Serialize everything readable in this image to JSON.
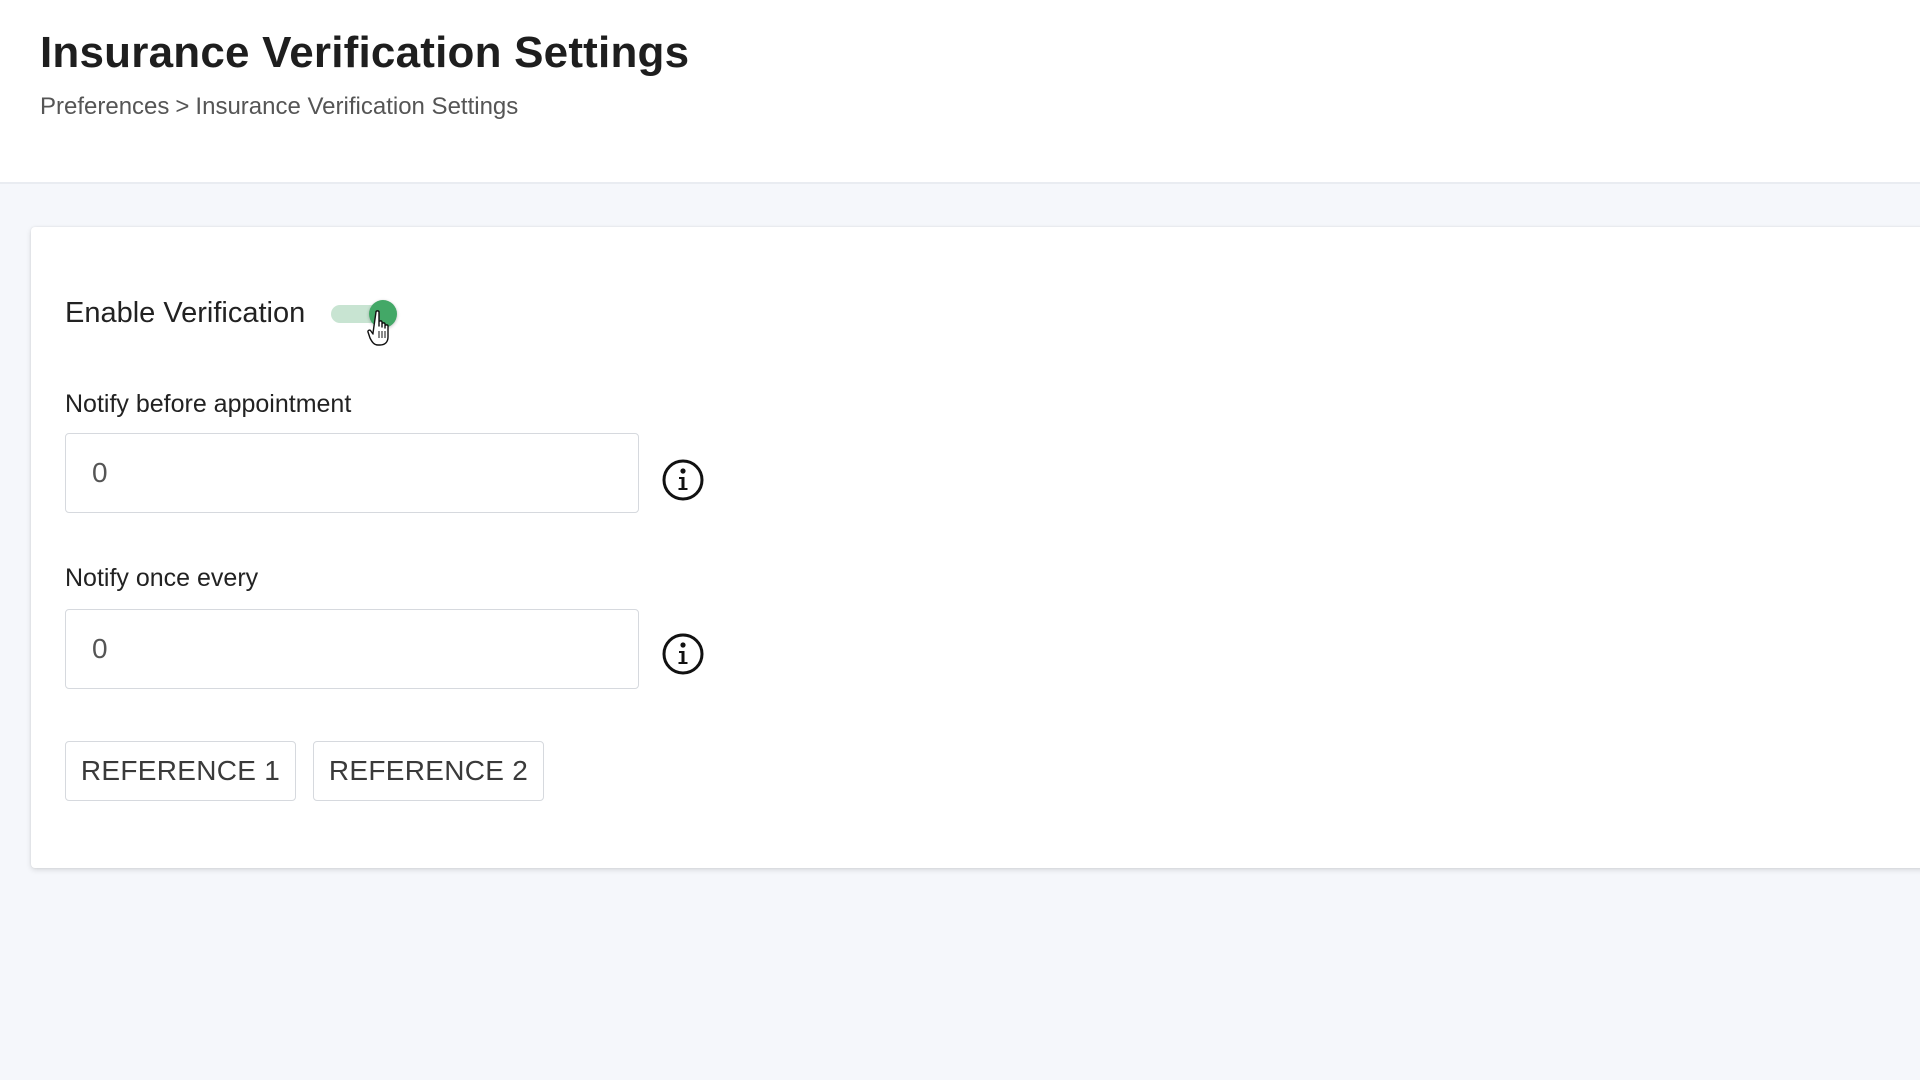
{
  "header": {
    "title": "Insurance Verification Settings",
    "breadcrumb": {
      "parent": "Preferences",
      "separator": ">",
      "current": "Insurance Verification Settings"
    }
  },
  "settings": {
    "enable_verification": {
      "label": "Enable Verification",
      "on": true
    },
    "notify_before": {
      "label": "Notify before appointment",
      "value": "0",
      "info_icon": "info-circle-icon"
    },
    "notify_every": {
      "label": "Notify once every",
      "value": "0",
      "info_icon": "info-circle-icon"
    },
    "buttons": {
      "reference1": "REFERENCE 1",
      "reference2": "REFERENCE 2"
    }
  },
  "colors": {
    "toggle_on": "#43a867",
    "toggle_track": "#c8e4d2",
    "background": "#f5f7fb"
  }
}
